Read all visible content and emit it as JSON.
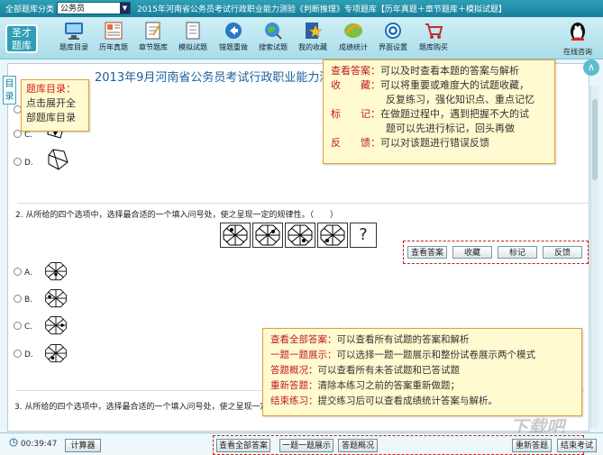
{
  "topbar": {
    "category_label": "全部题库分类",
    "category_value": "公务员",
    "title": "2015年河南省公务员考试行政职业能力测验《判断推理》专项题库【历年真题＋章节题库＋模拟试题】"
  },
  "logo": {
    "text": "圣才题库"
  },
  "toolbar": [
    {
      "label": "题库目录",
      "icon": "monitor-icon"
    },
    {
      "label": "历年真题",
      "icon": "newspaper-icon"
    },
    {
      "label": "章节题库",
      "icon": "notebook-icon"
    },
    {
      "label": "模拟试题",
      "icon": "document-icon"
    },
    {
      "label": "错题重做",
      "icon": "redo-arrow-icon"
    },
    {
      "label": "搜索试题",
      "icon": "globe-search-icon"
    },
    {
      "label": "我的收藏",
      "icon": "star-icon"
    },
    {
      "label": "成绩统计",
      "icon": "chart-leaf-icon"
    },
    {
      "label": "界面设置",
      "icon": "gear-icon"
    },
    {
      "label": "题库购买",
      "icon": "cart-icon"
    }
  ],
  "qq": {
    "label": "在线咨询",
    "icon": "penguin-icon"
  },
  "main": {
    "title": "2013年9月河南省公务员考试行政职业能力测",
    "side_tab": "目录",
    "up_button": "∧"
  },
  "callouts": {
    "catalog": {
      "lines": [
        "题库目录：",
        "点击展开全",
        "部题库目录"
      ]
    },
    "answer": {
      "rows": [
        {
          "key": "查看答案：",
          "val": "可以及时查看本题的答案与解析"
        },
        {
          "key": "收　　藏：",
          "val": "可以将重要或难度大的试题收藏，"
        },
        {
          "key": "",
          "val": "反复练习，强化知识点、重点记忆"
        },
        {
          "key": "标　　记：",
          "val": "在做题过程中，遇到把握不大的试"
        },
        {
          "key": "",
          "val": "题可以先进行标记，回头再做"
        },
        {
          "key": "反　　馈：",
          "val": "可以对该题进行错误反馈"
        }
      ]
    },
    "bottom": {
      "rows": [
        {
          "key": "查看全部答案：",
          "val": "可以查看所有试题的答案和解析"
        },
        {
          "key": "一题一题展示：",
          "val": "可以选择一题一题展示和整份试卷展示两个模式"
        },
        {
          "key": "答题概况：",
          "val": "可以查看所有未答试题和已答试题"
        },
        {
          "key": "重新答题：",
          "val": "清除本练习之前的答案重新做题；"
        },
        {
          "key": "结束练习：",
          "val": "提交练习后可以查看成绩统计答案与解析。"
        }
      ]
    }
  },
  "question1": {
    "options": [
      "C.",
      "D."
    ],
    "buttons": [
      "查看答案",
      "收藏",
      "标记",
      "反馈"
    ]
  },
  "question2": {
    "text": "2. 从所给的四个选项中，选择最合适的一个填入问号处，使之呈现一定的规律性。（　　）",
    "sequence_mark": "?",
    "options": [
      "A.",
      "B.",
      "C.",
      "D."
    ]
  },
  "question3": {
    "text": "3. 从所给的四个选项中，选择最合适的一个填入问号处，使之呈现一定的规律性。"
  },
  "bottombar": {
    "timer": "00:39:47",
    "calculator": "计算器",
    "buttons": [
      "查看全部答案",
      "一题一题展示",
      "答题概况",
      "重新答题",
      "结束考试"
    ]
  },
  "watermark": "下载吧"
}
